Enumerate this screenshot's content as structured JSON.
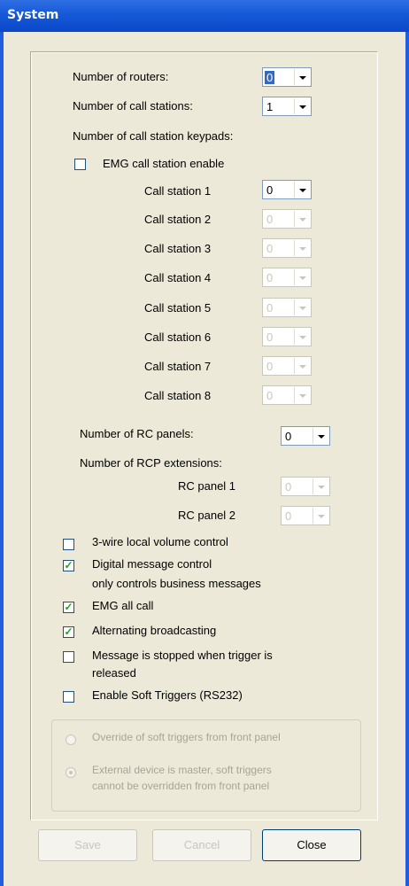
{
  "window": {
    "title": "System"
  },
  "routers": {
    "label": "Number of routers:",
    "value": "0"
  },
  "call_stations": {
    "label": "Number of call stations:",
    "value": "1"
  },
  "keypads": {
    "label": "Number of call station keypads:"
  },
  "emg_call_station": {
    "label": "EMG call station enable",
    "checked": false
  },
  "stations": [
    {
      "label": "Call station 1",
      "value": "0"
    },
    {
      "label": "Call station 2",
      "value": "0"
    },
    {
      "label": "Call station 3",
      "value": "0"
    },
    {
      "label": "Call station 4",
      "value": "0"
    },
    {
      "label": "Call station 5",
      "value": "0"
    },
    {
      "label": "Call station 6",
      "value": "0"
    },
    {
      "label": "Call station 7",
      "value": "0"
    },
    {
      "label": "Call station 8",
      "value": "0"
    }
  ],
  "rc_panels": {
    "label": "Number of RC panels:",
    "value": "0"
  },
  "rcp_extensions": {
    "label": "Number of RCP extensions:"
  },
  "rc_panel_1": {
    "label": "RC panel 1",
    "value": "0"
  },
  "rc_panel_2": {
    "label": "RC panel 2",
    "value": "0"
  },
  "options": {
    "three_wire": {
      "label": "3-wire local volume control",
      "checked": false
    },
    "digital_msg": {
      "label": "Digital message control",
      "label2": "only controls business messages",
      "checked": true
    },
    "emg_all_call": {
      "label": "EMG all call",
      "checked": true
    },
    "alternating": {
      "label": "Alternating broadcasting",
      "checked": true
    },
    "msg_stopped": {
      "label": "Message is stopped when trigger is",
      "label2": "released",
      "checked": false
    },
    "soft_triggers": {
      "label": "Enable Soft Triggers (RS232)",
      "checked": false
    }
  },
  "soft_group": {
    "override": "Override of soft triggers from front panel",
    "external_1": "External device is master, soft triggers",
    "external_2": "cannot be overridden from front panel"
  },
  "buttons": {
    "save": "Save",
    "cancel": "Cancel",
    "close": "Close"
  }
}
